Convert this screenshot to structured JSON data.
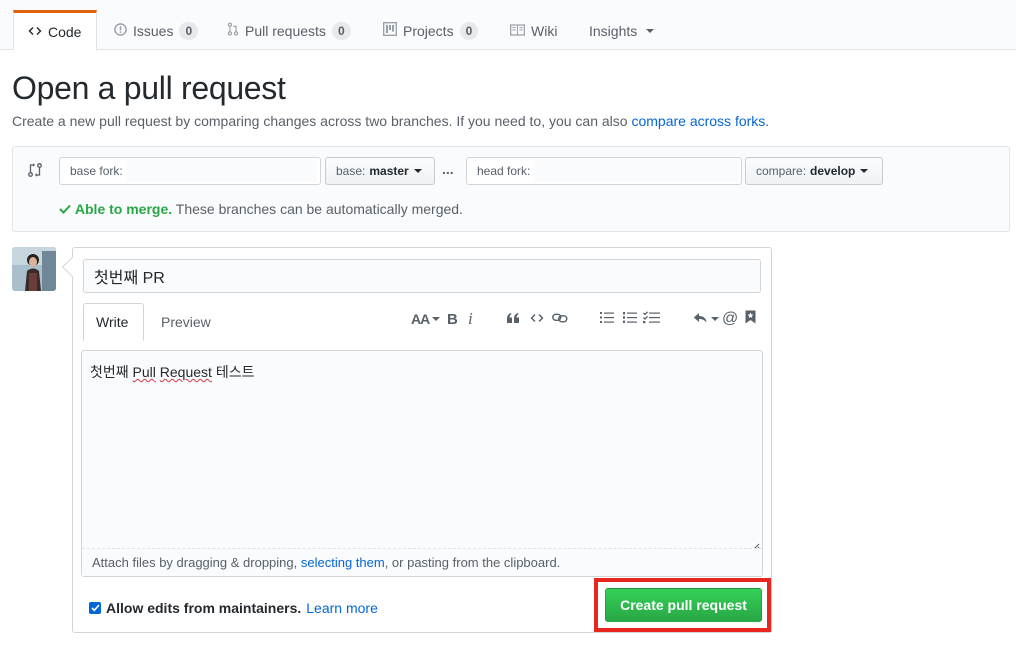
{
  "tabs": {
    "code": "Code",
    "issues": "Issues",
    "issues_count": "0",
    "pull_requests": "Pull requests",
    "pull_requests_count": "0",
    "projects": "Projects",
    "projects_count": "0",
    "wiki": "Wiki",
    "insights": "Insights"
  },
  "page": {
    "title": "Open a pull request",
    "description": "Create a new pull request by comparing changes across two branches. If you need to, you can also",
    "compare_link": "compare across forks",
    "period": "."
  },
  "range": {
    "base_fork_label": "base fork:",
    "base_label": "base:",
    "base_branch": "master",
    "dots": "...",
    "head_fork_label": "head fork:",
    "compare_label": "compare:",
    "compare_branch": "develop",
    "merge_status": "Able to merge.",
    "merge_message": "These branches can be automatically merged."
  },
  "form": {
    "title_value": "첫번째 PR",
    "tab_write": "Write",
    "tab_preview": "Preview",
    "body_prefix": "첫번째 ",
    "body_pull": "Pull",
    "body_request": "Request",
    "body_suffix": " 테스트",
    "attach_prefix": "Attach files by dragging & dropping, ",
    "attach_link": "selecting them",
    "attach_suffix": ", or pasting from the clipboard.",
    "allow_edits": "Allow edits from maintainers.",
    "learn_more": "Learn more",
    "submit": "Create pull request"
  },
  "toolbar": {
    "header": "AA",
    "bold": "B",
    "italic": "i",
    "mention": "@"
  },
  "colors": {
    "accent": "#0366d6",
    "success": "#28a745",
    "tab_active": "#e36209",
    "highlight": "#e8251f"
  }
}
